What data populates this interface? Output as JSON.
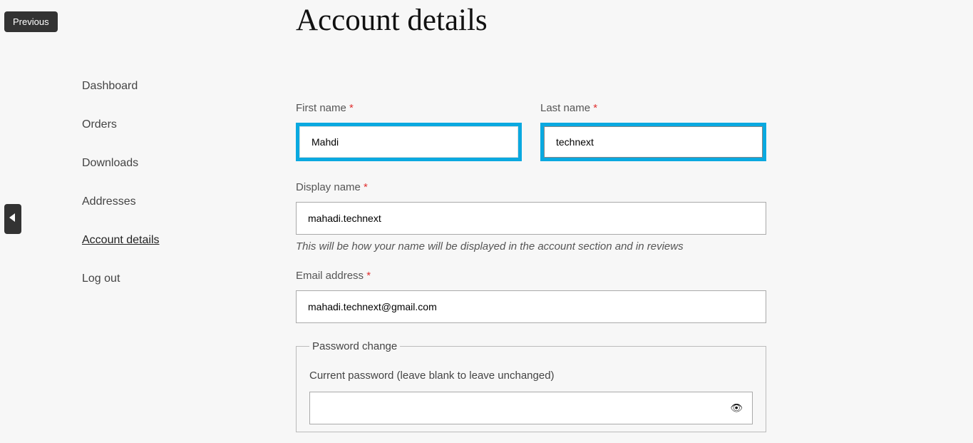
{
  "previous_label": "Previous",
  "page_title": "Account details",
  "sidebar": {
    "items": [
      {
        "label": "Dashboard",
        "active": false
      },
      {
        "label": "Orders",
        "active": false
      },
      {
        "label": "Downloads",
        "active": false
      },
      {
        "label": "Addresses",
        "active": false
      },
      {
        "label": "Account details",
        "active": true
      },
      {
        "label": "Log out",
        "active": false
      }
    ]
  },
  "form": {
    "first_name": {
      "label": "First name",
      "value": "Mahdi"
    },
    "last_name": {
      "label": "Last name",
      "value": "technext"
    },
    "display_name": {
      "label": "Display name",
      "value": "mahadi.technext",
      "hint": "This will be how your name will be displayed in the account section and in reviews"
    },
    "email": {
      "label": "Email address",
      "value": "mahadi.technext@gmail.com"
    },
    "password": {
      "legend": "Password change",
      "current_label": "Current password (leave blank to leave unchanged)",
      "current_value": ""
    },
    "required_marker": "*"
  }
}
